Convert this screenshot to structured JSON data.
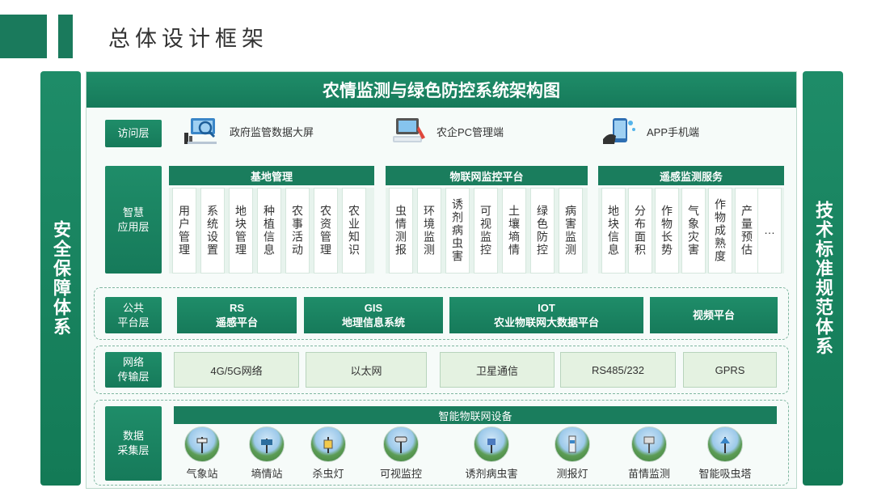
{
  "page": {
    "title": "总体设计框架"
  },
  "sides": {
    "left": "安全保障体系",
    "right": "技术标准规范体系"
  },
  "banner": "农情监测与绿色防控系统架构图",
  "access": {
    "label": "访问层",
    "items": [
      {
        "label": "政府监管数据大屏",
        "icon": "dashboard-screen-icon"
      },
      {
        "label": "农企PC管理端",
        "icon": "pc-terminal-icon"
      },
      {
        "label": "APP手机端",
        "icon": "mobile-phone-icon"
      }
    ]
  },
  "app": {
    "label": "智慧\n应用层",
    "groups": [
      {
        "title": "基地管理",
        "items": [
          "用户管理",
          "系统设置",
          "地块管理",
          "种植信息",
          "农事活动",
          "农资管理",
          "农业知识"
        ]
      },
      {
        "title": "物联网监控平台",
        "items": [
          "虫情测报",
          "环境监测",
          "诱剂病虫害",
          "可视监控",
          "土壤墒情",
          "绿色防控",
          "病害监测"
        ]
      },
      {
        "title": "遥感监测服务",
        "items": [
          "地块信息",
          "分布面积",
          "作物长势",
          "气象灾害",
          "作物成熟度",
          "产量预估",
          "…"
        ]
      }
    ]
  },
  "platform": {
    "label": "公共\n平台层",
    "items": [
      {
        "line1": "RS",
        "line2": "遥感平台"
      },
      {
        "line1": "GIS",
        "line2": "地理信息系统"
      },
      {
        "line1": "IOT",
        "line2": "农业物联网大数据平台"
      },
      {
        "line1": "视频平台",
        "line2": ""
      }
    ]
  },
  "network": {
    "label": "网络\n传输层",
    "items": [
      "4G/5G网络",
      "以太网",
      "卫星通信",
      "RS485/232",
      "GPRS"
    ]
  },
  "data": {
    "label": "数据\n采集层",
    "header": "智能物联网设备",
    "devices": [
      "气象站",
      "墒情站",
      "杀虫灯",
      "可视监控",
      "诱剂病虫害",
      "测报灯",
      "苗情监测",
      "智能吸虫塔"
    ]
  },
  "colors": {
    "primary": "#1a7d5d",
    "light": "#e4f2e1",
    "dash": "#7fb6a0"
  }
}
